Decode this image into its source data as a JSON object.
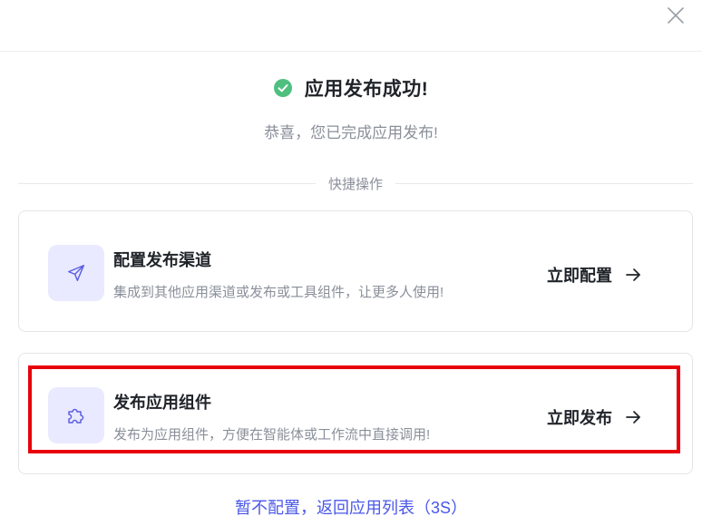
{
  "dialog": {
    "close_icon": "close-icon",
    "success_icon": "check-circle-icon",
    "success_color": "#4fbf7f",
    "title": "应用发布成功!",
    "subtitle": "恭喜，您已完成应用发布!",
    "section_label": "快捷操作"
  },
  "cards": [
    {
      "icon": "send-icon",
      "title": "配置发布渠道",
      "description": "集成到其他应用渠道或发布或工具组件，让更多人使用!",
      "action_label": "立即配置",
      "action_icon": "arrow-right-icon"
    },
    {
      "icon": "puzzle-icon",
      "title": "发布应用组件",
      "description": "发布为应用组件，方便在智能体或工作流中直接调用!",
      "action_label": "立即发布",
      "action_icon": "arrow-right-icon"
    }
  ],
  "footer": {
    "link_text": "暂不配置，返回应用列表（3S）"
  },
  "colors": {
    "accent": "#4a57e8",
    "icon_bg": "#e9e9ff",
    "highlight": "#e8000b"
  }
}
